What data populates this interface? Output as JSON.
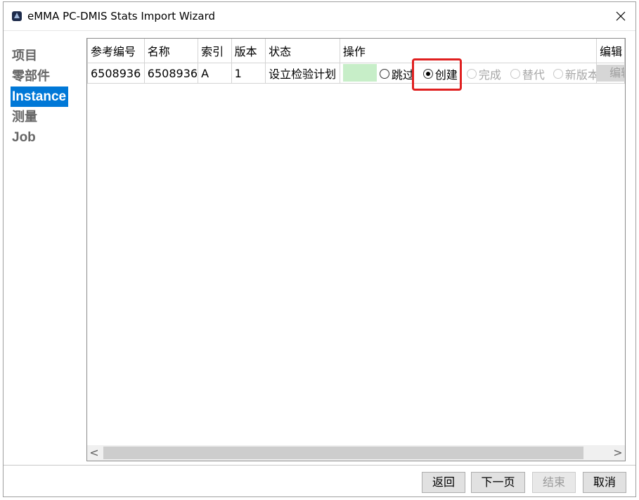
{
  "window": {
    "title": "eMMA PC-DMIS Stats Import Wizard"
  },
  "nav": {
    "items": [
      {
        "label": "项目",
        "active": false
      },
      {
        "label": "零部件",
        "active": false
      },
      {
        "label": "Instance",
        "active": true
      },
      {
        "label": "测量",
        "active": false
      },
      {
        "label": "Job",
        "active": false
      }
    ]
  },
  "table": {
    "headers": [
      "参考编号",
      "名称",
      "索引",
      "版本",
      "状态",
      "操作",
      "编辑"
    ],
    "rows": [
      {
        "ref": "6508936",
        "name": "6508936",
        "index": "A",
        "version": "1",
        "status": "设立检验计划",
        "options": [
          {
            "label": "跳过",
            "checked": false,
            "enabled": true
          },
          {
            "label": "创建",
            "checked": true,
            "enabled": true
          },
          {
            "label": "完成",
            "checked": false,
            "enabled": false
          },
          {
            "label": "替代",
            "checked": false,
            "enabled": false
          },
          {
            "label": "新版本",
            "checked": false,
            "enabled": false
          }
        ],
        "edit_label": "编辑"
      }
    ]
  },
  "scrollbar": {
    "left_arrow": "<",
    "right_arrow": ">"
  },
  "footer": {
    "back": "返回",
    "next": "下一页",
    "finish": "结束",
    "cancel": "取消"
  },
  "colors": {
    "accent": "#0078d7",
    "ref_text": "#3c9a3c",
    "op_indicator": "#c7eec8",
    "highlight": "#e02020"
  }
}
